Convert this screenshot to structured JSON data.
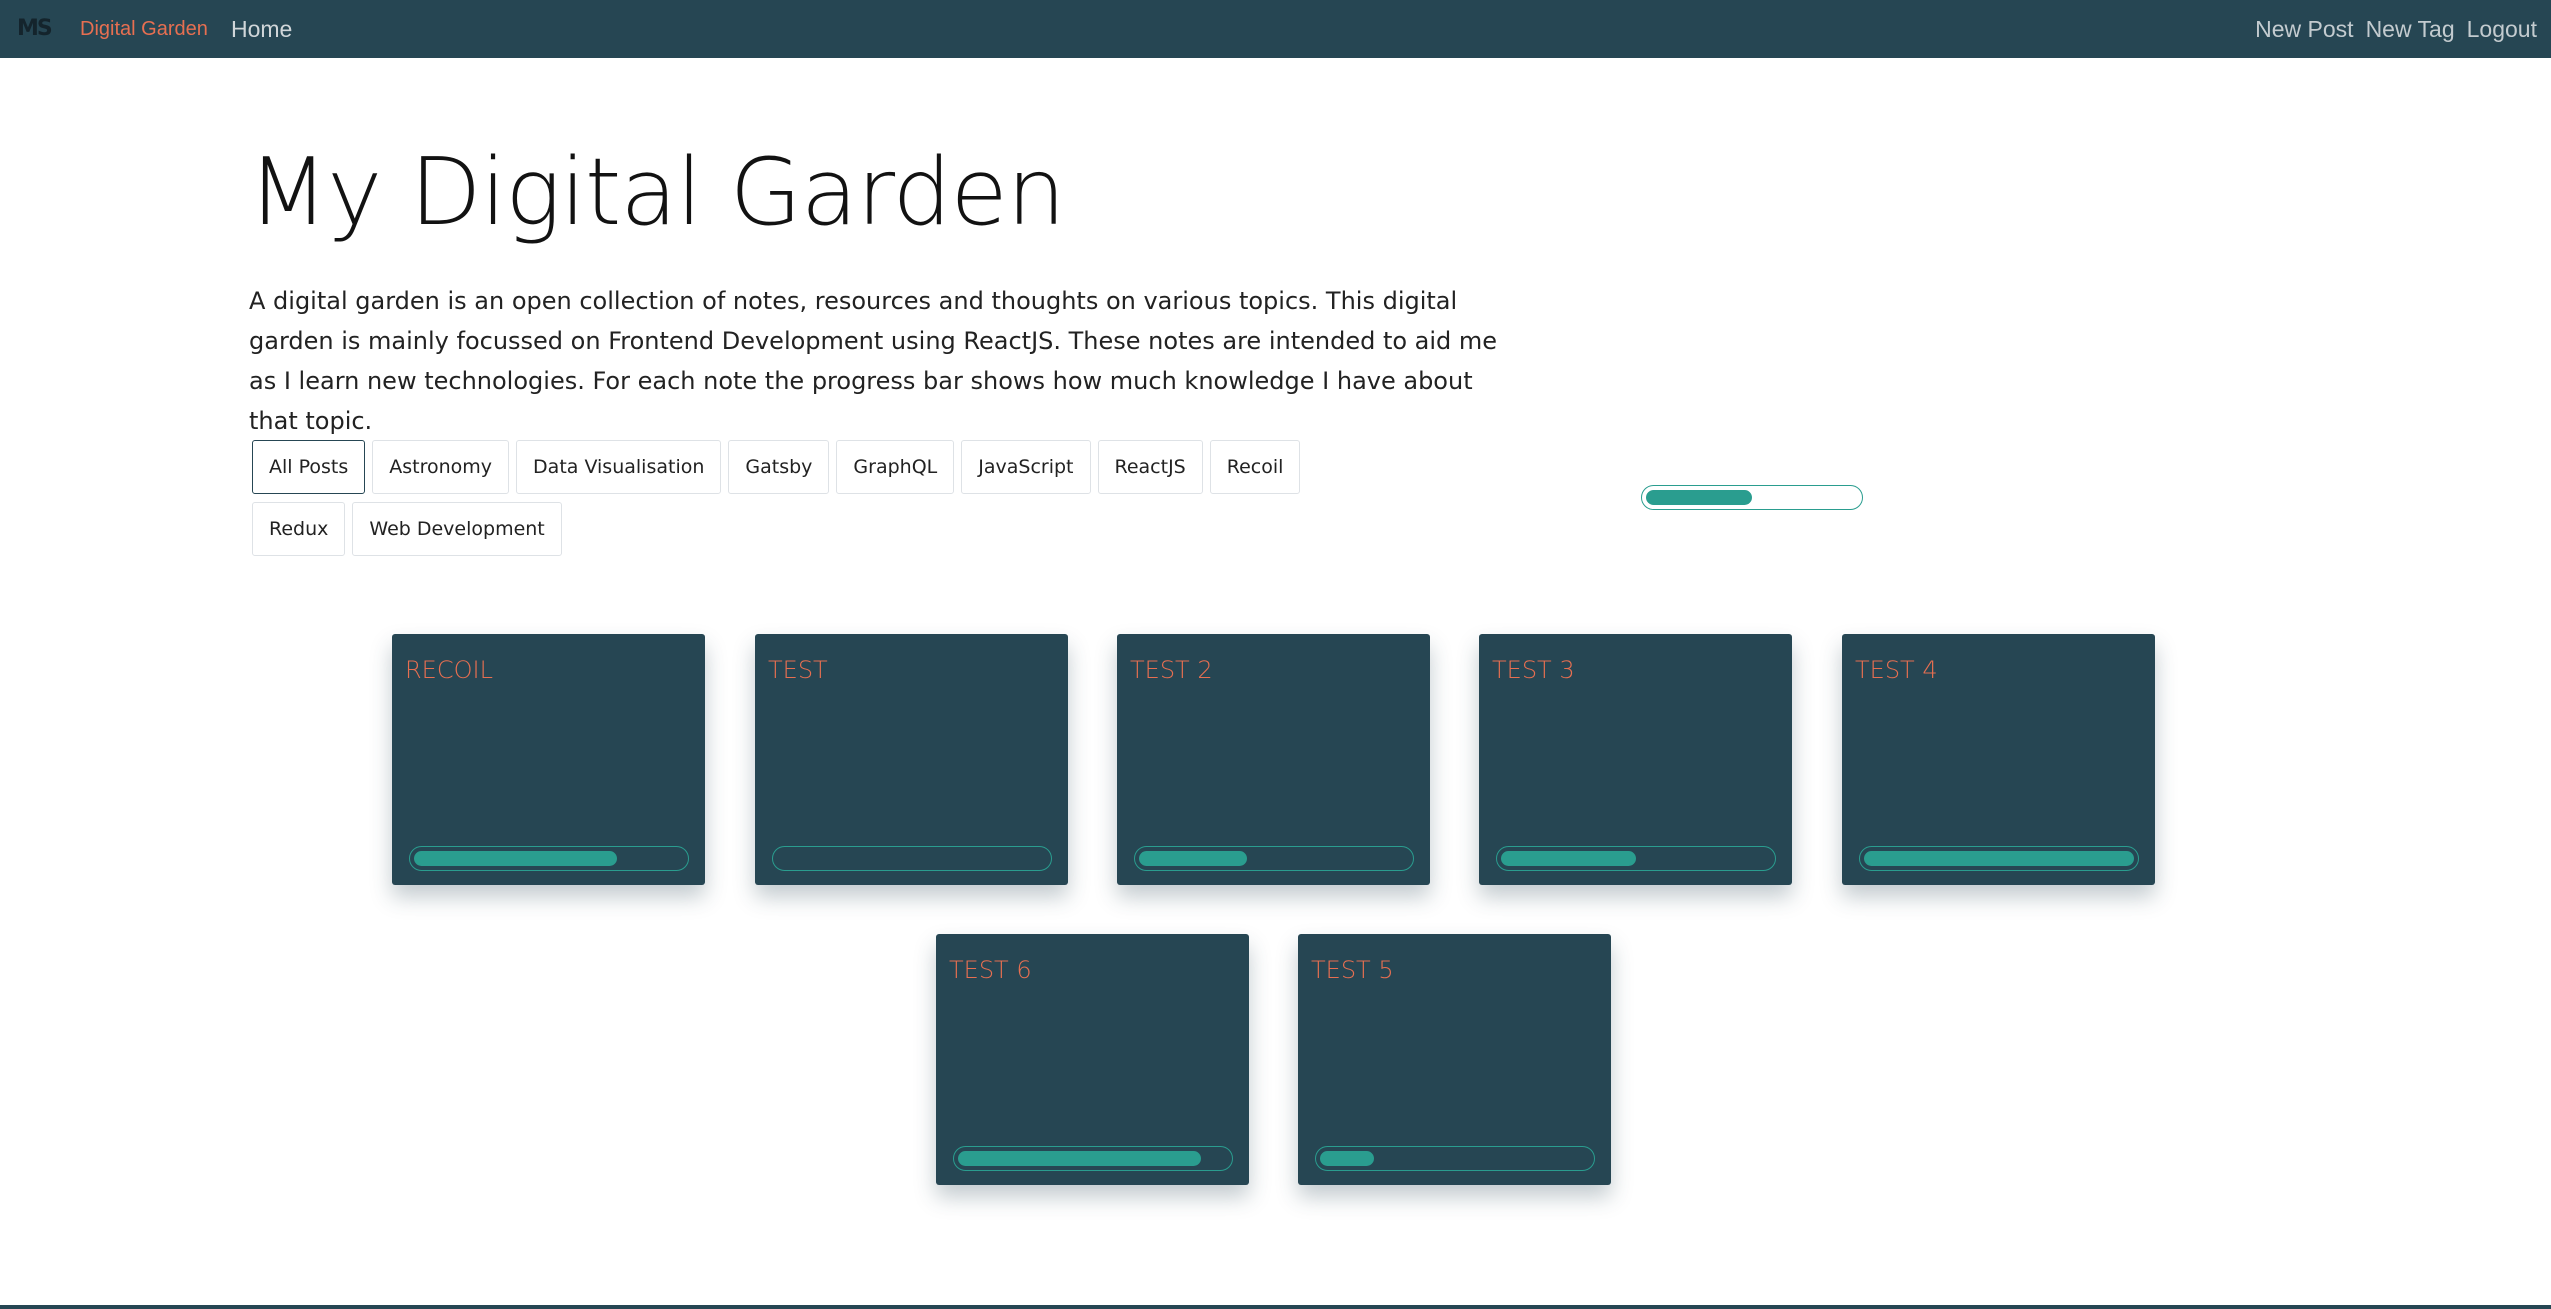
{
  "navbar": {
    "logo": "MS",
    "brand": "Digital Garden",
    "home": "Home",
    "new_post": "New Post",
    "new_tag": "New Tag",
    "logout": "Logout"
  },
  "page": {
    "title": "My Digital Garden",
    "intro": "A digital garden is an open collection of notes, resources and thoughts on various topics. This digital garden is mainly focussed on Frontend Development using ReactJS. These notes are intended to aid me as I learn new technologies. For each note the progress bar shows how much knowledge I have about that topic."
  },
  "tags": [
    {
      "label": "All Posts",
      "active": true
    },
    {
      "label": "Astronomy"
    },
    {
      "label": "Data Visualisation"
    },
    {
      "label": "Gatsby"
    },
    {
      "label": "GraphQL"
    },
    {
      "label": "JavaScript"
    },
    {
      "label": "ReactJS"
    },
    {
      "label": "Recoil"
    },
    {
      "label": "Redux"
    },
    {
      "label": "Web Development"
    }
  ],
  "overall_progress": 0.5,
  "cards": [
    {
      "title": "RECOIL",
      "progress": 0.75
    },
    {
      "title": "TEST",
      "progress": 0
    },
    {
      "title": "TEST 2",
      "progress": 0.4
    },
    {
      "title": "TEST 3",
      "progress": 0.5
    },
    {
      "title": "TEST 4",
      "progress": 1.0
    },
    {
      "title": "TEST 6",
      "progress": 0.9
    },
    {
      "title": "TEST 5",
      "progress": 0.2
    }
  ],
  "colors": {
    "navbar": "#264653",
    "accent": "#e76f51",
    "progress": "#2a9d8f"
  }
}
